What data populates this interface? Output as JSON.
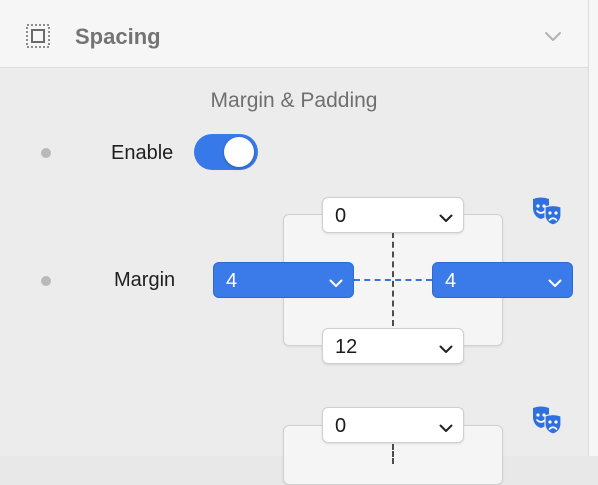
{
  "section": {
    "title": "Spacing",
    "icon": "spacing-icon",
    "collapse_icon": "chevron-down-icon"
  },
  "subsection": {
    "title": "Margin & Padding"
  },
  "enable": {
    "label": "Enable",
    "value": true
  },
  "margin": {
    "label": "Margin",
    "top": "0",
    "left": "4",
    "right": "4",
    "bottom": "12"
  },
  "padding": {
    "top": "0"
  },
  "icons": {
    "theater": "theater-masks-icon"
  },
  "colors": {
    "accent": "#3a7be9",
    "header_bg": "#f6f6f6",
    "panel_bg": "#ececec"
  }
}
